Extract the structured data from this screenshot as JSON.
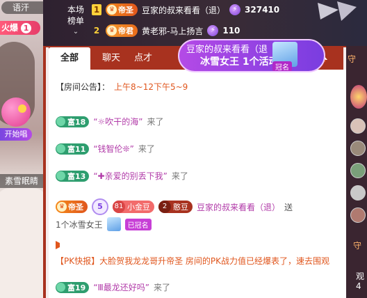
{
  "left_stream": {
    "top_text": "语汗",
    "fire_label": "火爆",
    "fire_count": "1",
    "sing_label": "开始唱",
    "streamer_name": "素雪眠睛"
  },
  "ranking": {
    "label_line1": "本场",
    "label_line2": "榜单",
    "rows": [
      {
        "rank": "1",
        "badge": "帝圣",
        "name": "豆家的叔来看看（退）",
        "score": "327410"
      },
      {
        "rank": "2",
        "badge": "帝君",
        "name": "黄老邪-马上扬言",
        "score": "110"
      }
    ]
  },
  "tabs": [
    "全部",
    "聊天",
    "点才"
  ],
  "popup": {
    "line1": "豆家的叔来看看（退",
    "line2": "冰雪女王 1个活动",
    "crowned": "冠名"
  },
  "notice": {
    "prefix": "【房间公告】：",
    "text": "上午8~12下午5~9"
  },
  "messages": [
    {
      "level": "富18",
      "name": "“☼吹干的海”",
      "action": "来了"
    },
    {
      "level": "富11",
      "name": "“钱智伦❊”",
      "action": "来了"
    },
    {
      "level": "富13",
      "name": "“✚亲爱的别丢下我”",
      "action": "来了"
    }
  ],
  "gift_msg": {
    "badge": "帝圣",
    "ring": "5",
    "jin_level": "81",
    "jin_name": "小金豆",
    "han_level": "2",
    "han_name": "憨豆",
    "user": "豆家的叔来看看（退）",
    "action": "送",
    "gift_text": "1个冰雪女王",
    "crowned": "已冠名"
  },
  "pk_msg": "【PK快报】大脸贺我龙龙哥升帝圣 房间的PK战力值已经爆表了，速去围观",
  "last_msg": {
    "level": "富19",
    "name": "“Ⅲ最龙还好吗”",
    "action": "来了"
  },
  "right_strip": {
    "head": "守",
    "foot1": "守",
    "foot2": "观\n4"
  }
}
